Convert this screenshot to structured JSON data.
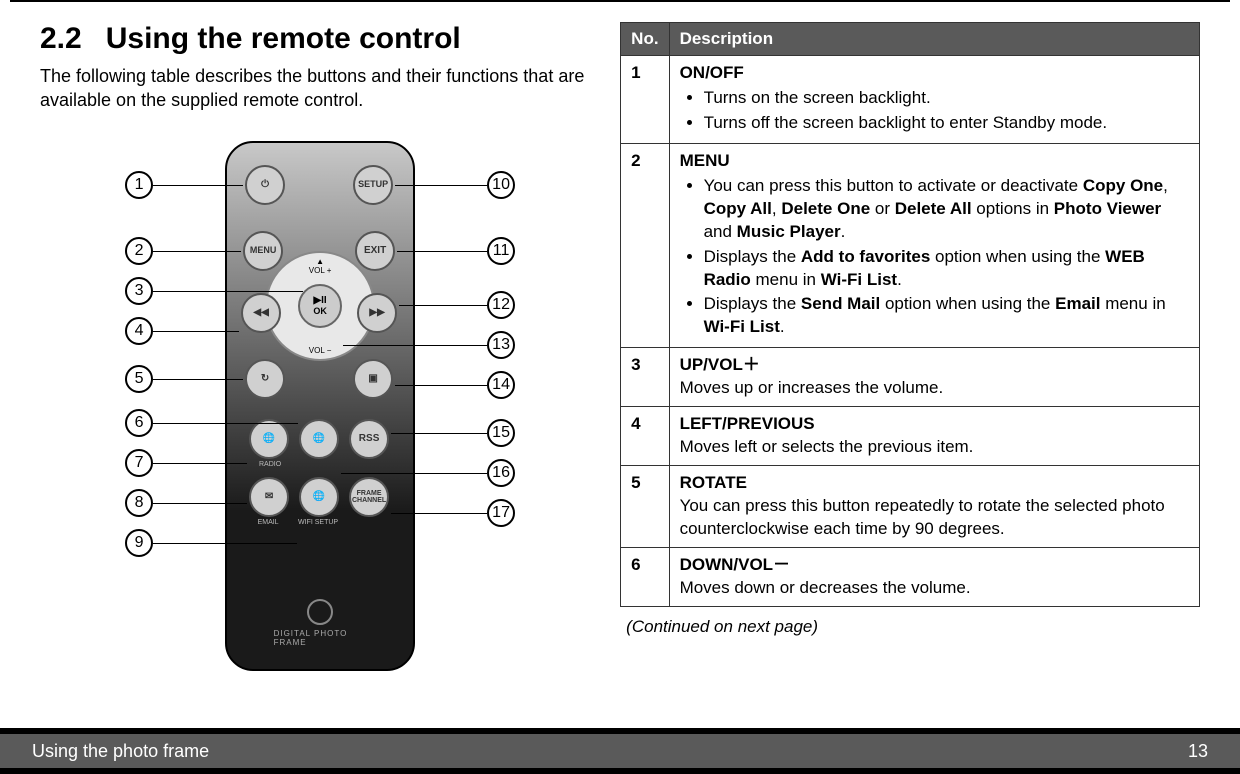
{
  "section_number": "2.2",
  "section_title": "Using the remote control",
  "intro": "The following table describes the buttons and their functions that are available on the supplied remote control.",
  "table_header": {
    "no": "No.",
    "desc": "Description"
  },
  "rows": {
    "r1": {
      "no": "1",
      "title": "ON/OFF",
      "b1": "Turns on the screen backlight.",
      "b2": "Turns off the screen backlight to enter Standby mode."
    },
    "r2": {
      "no": "2",
      "title": "MENU",
      "b1a": "You can press this button to activate or deactivate ",
      "b1_copyone": "Copy One",
      "b1_sep1": ", ",
      "b1_copyall": "Copy All",
      "b1_sep2": ", ",
      "b1_delone": "Delete One",
      "b1_or": " or ",
      "b1_delall": "Delete All",
      "b1_mid": " options in ",
      "b1_pv": "Photo Viewer",
      "b1_and": " and ",
      "b1_mp": "Music Player",
      "b1_end": ".",
      "b2a": "Displays the ",
      "b2_fav": "Add to favorites",
      "b2b": " option when using the ",
      "b2_web": "WEB Radio",
      "b2c": " menu in ",
      "b2_wifi": "Wi-Fi List",
      "b2d": ".",
      "b3a": "Displays the ",
      "b3_send": "Send Mail",
      "b3b": " option when using the ",
      "b3_email": "Email",
      "b3c": " menu in ",
      "b3_wifi": "Wi-Fi List",
      "b3d": "."
    },
    "r3": {
      "no": "3",
      "title": "UP/VOL＋",
      "text": "Moves up or increases the volume."
    },
    "r4": {
      "no": "4",
      "title": "LEFT/PREVIOUS",
      "text": "Moves left or selects the previous item."
    },
    "r5": {
      "no": "5",
      "title": "ROTATE",
      "text": "You can press this button repeatedly to rotate the selected photo counterclockwise each time by 90 degrees."
    },
    "r6": {
      "no": "6",
      "title": "DOWN/VOL－",
      "text": "Moves down or decreases the volume."
    }
  },
  "continued": "(Continued on next page)",
  "footer_left": "Using the photo frame",
  "footer_right": "13",
  "remote_buttons": {
    "power": "⏻",
    "setup": "SETUP",
    "menu": "MENU",
    "exit": "EXIT",
    "volup": "▲\nVOL +",
    "voldn": "VOL −",
    "ok": "▶II\nOK",
    "rew": "◀◀",
    "fwd": "▶▶",
    "rotate": "↻",
    "pip": "▣",
    "radio": "🌐",
    "globe": "🌐",
    "rss": "RSS",
    "email": "✉",
    "wifi": "🌐",
    "frame": "FRAME\nCHANNEL",
    "lbl_radio": "RADIO",
    "lbl_email": "EMAIL",
    "lbl_wifi": "WIFI SETUP",
    "brand": "DIGITAL PHOTO FRAME"
  },
  "callouts": {
    "c1": "1",
    "c2": "2",
    "c3": "3",
    "c4": "4",
    "c5": "5",
    "c6": "6",
    "c7": "7",
    "c8": "8",
    "c9": "9",
    "c10": "10",
    "c11": "11",
    "c12": "12",
    "c13": "13",
    "c14": "14",
    "c15": "15",
    "c16": "16",
    "c17": "17"
  }
}
